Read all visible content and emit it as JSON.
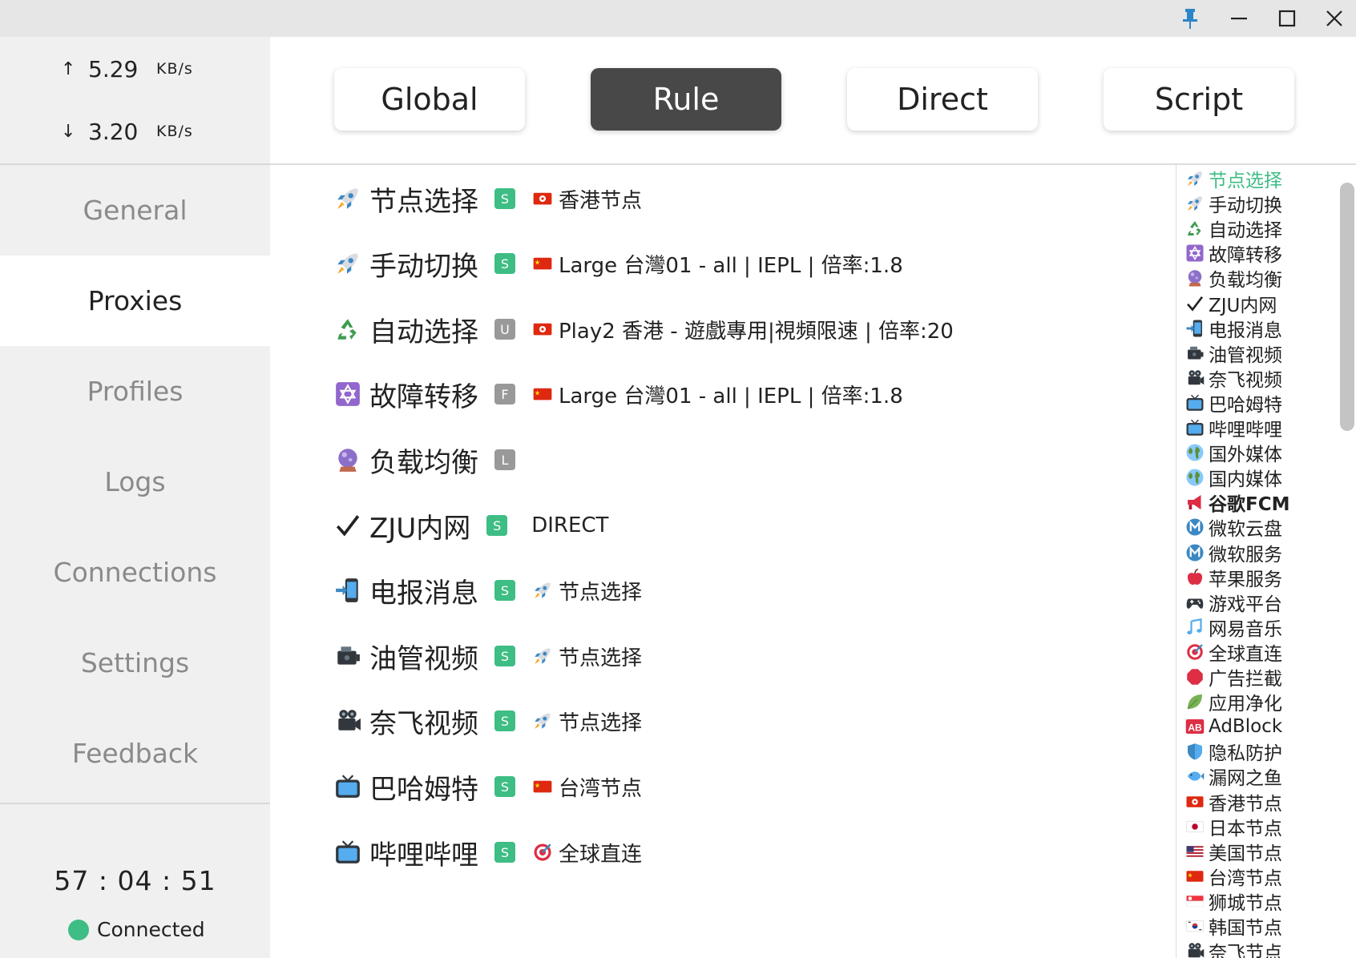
{
  "titlebar": {
    "controls": [
      {
        "name": "pin-button",
        "icon": "pin-icon",
        "color": "#2a86c8"
      },
      {
        "name": "minimize-button",
        "icon": "minimize-icon",
        "color": "#222222"
      },
      {
        "name": "maximize-button",
        "icon": "maximize-icon",
        "color": "#222222"
      },
      {
        "name": "close-button",
        "icon": "close-icon",
        "color": "#222222"
      }
    ]
  },
  "traffic": {
    "up_arrow": "↑",
    "up_value": "5.29",
    "up_unit": "KB/s",
    "down_arrow": "↓",
    "down_value": "3.20",
    "down_unit": "KB/s"
  },
  "nav": [
    {
      "label": "General",
      "active": false
    },
    {
      "label": "Proxies",
      "active": true
    },
    {
      "label": "Profiles",
      "active": false
    },
    {
      "label": "Logs",
      "active": false
    },
    {
      "label": "Connections",
      "active": false
    },
    {
      "label": "Settings",
      "active": false
    },
    {
      "label": "Feedback",
      "active": false
    }
  ],
  "status": {
    "uptime": "57 : 04 : 51",
    "connection": "Connected",
    "dot_color": "#3ebd84"
  },
  "modes": [
    {
      "label": "Global",
      "active": false
    },
    {
      "label": "Rule",
      "active": true
    },
    {
      "label": "Direct",
      "active": false
    },
    {
      "label": "Script",
      "active": false
    }
  ],
  "groups": [
    {
      "icon": "rocket-icon",
      "name": "节点选择",
      "badge": "S",
      "selected_icon": "hk-flag-icon",
      "selected": "香港节点"
    },
    {
      "icon": "rocket-icon",
      "name": "手动切换",
      "badge": "S",
      "selected_icon": "cn-flag-icon",
      "selected": "Large 台灣01 - all | IEPL | 倍率:1.8"
    },
    {
      "icon": "recycle-icon",
      "name": "自动选择",
      "badge": "U",
      "selected_icon": "hk-flag-icon",
      "selected": "Play2 香港 - 遊戲專用|視頻限速 | 倍率:20"
    },
    {
      "icon": "star-of-david-icon",
      "name": "故障转移",
      "badge": "F",
      "selected_icon": "cn-flag-icon",
      "selected": "Large 台灣01 - all | IEPL | 倍率:1.8"
    },
    {
      "icon": "crystal-ball-icon",
      "name": "负载均衡",
      "badge": "L",
      "selected_icon": "",
      "selected": ""
    },
    {
      "icon": "check-icon",
      "name": "ZJU内网",
      "badge": "S",
      "selected_icon": "",
      "selected": "DIRECT"
    },
    {
      "icon": "phone-arrow-icon",
      "name": "电报消息",
      "badge": "S",
      "selected_icon": "rocket-icon",
      "selected": "节点选择"
    },
    {
      "icon": "camera-icon",
      "name": "油管视频",
      "badge": "S",
      "selected_icon": "rocket-icon",
      "selected": "节点选择"
    },
    {
      "icon": "movie-camera-icon",
      "name": "奈飞视频",
      "badge": "S",
      "selected_icon": "rocket-icon",
      "selected": "节点选择"
    },
    {
      "icon": "tv-icon",
      "name": "巴哈姆特",
      "badge": "S",
      "selected_icon": "cn-flag-icon",
      "selected": "台湾节点"
    },
    {
      "icon": "tv-icon",
      "name": "哔哩哔哩",
      "badge": "S",
      "selected_icon": "target-icon",
      "selected": "全球直连"
    }
  ],
  "group_list": [
    {
      "icon": "rocket-icon",
      "name": "节点选择",
      "highlight": true
    },
    {
      "icon": "rocket-icon",
      "name": "手动切换"
    },
    {
      "icon": "recycle-icon",
      "name": "自动选择"
    },
    {
      "icon": "star-of-david-icon",
      "name": "故障转移"
    },
    {
      "icon": "crystal-ball-icon",
      "name": "负载均衡"
    },
    {
      "icon": "check-icon",
      "name": "ZJU内网"
    },
    {
      "icon": "phone-arrow-icon",
      "name": "电报消息"
    },
    {
      "icon": "camera-icon",
      "name": "油管视频"
    },
    {
      "icon": "movie-camera-icon",
      "name": "奈飞视频"
    },
    {
      "icon": "tv-icon",
      "name": "巴哈姆特"
    },
    {
      "icon": "tv-icon",
      "name": "哔哩哔哩"
    },
    {
      "icon": "globe-icon",
      "name": "国外媒体"
    },
    {
      "icon": "globe-icon",
      "name": "国内媒体"
    },
    {
      "icon": "megaphone-icon",
      "name": "谷歌FCM",
      "bold": true
    },
    {
      "icon": "m-circle-icon",
      "name": "微软云盘"
    },
    {
      "icon": "m-circle-icon",
      "name": "微软服务"
    },
    {
      "icon": "apple-icon",
      "name": "苹果服务"
    },
    {
      "icon": "gamepad-icon",
      "name": "游戏平台"
    },
    {
      "icon": "music-icon",
      "name": "网易音乐"
    },
    {
      "icon": "target-icon",
      "name": "全球直连"
    },
    {
      "icon": "stop-sign-icon",
      "name": "广告拦截"
    },
    {
      "icon": "leaf-icon",
      "name": "应用净化"
    },
    {
      "icon": "ab-icon",
      "name": "AdBlock"
    },
    {
      "icon": "shield-icon",
      "name": "隐私防护"
    },
    {
      "icon": "fish-icon",
      "name": "漏网之鱼"
    },
    {
      "icon": "hk-flag-icon",
      "name": "香港节点"
    },
    {
      "icon": "jp-flag-icon",
      "name": "日本节点"
    },
    {
      "icon": "us-flag-icon",
      "name": "美国节点"
    },
    {
      "icon": "cn-flag-icon",
      "name": "台湾节点"
    },
    {
      "icon": "sg-flag-icon",
      "name": "狮城节点"
    },
    {
      "icon": "kr-flag-icon",
      "name": "韩国节点"
    },
    {
      "icon": "movie-camera-icon",
      "name": "奈飞节点"
    }
  ],
  "colors": {
    "accent": "#3ebd84",
    "badge_other": "#999999",
    "active_mode": "#484848"
  }
}
